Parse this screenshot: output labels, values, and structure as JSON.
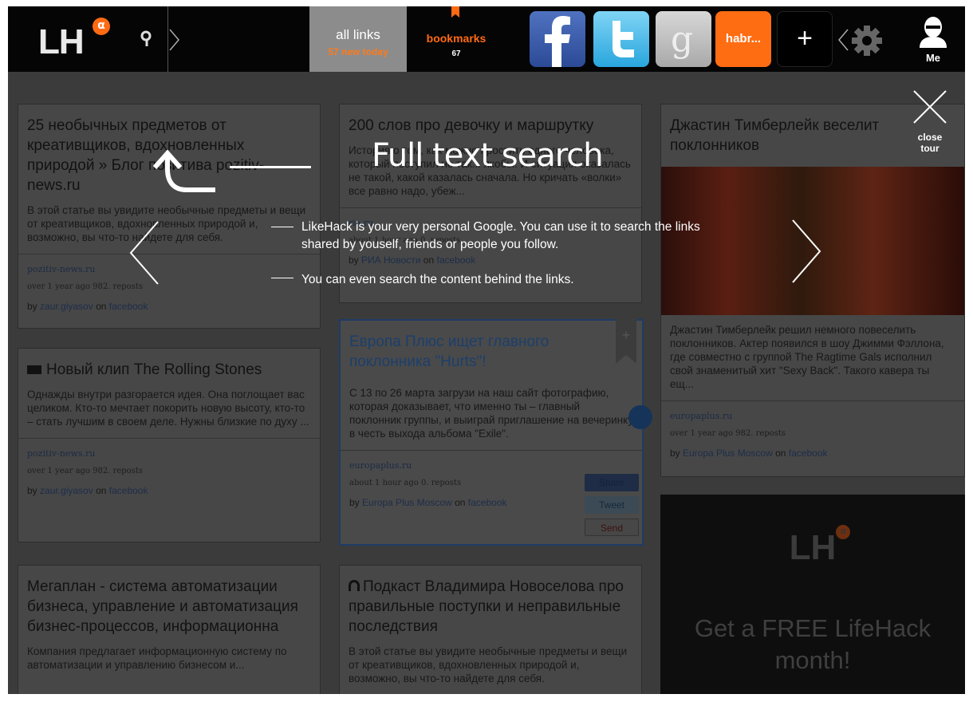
{
  "topbar": {
    "logo_text": "LH",
    "logo_badge": "α",
    "tabs": [
      {
        "label": "all links",
        "sub": "57 new today"
      },
      {
        "label": "bookmarks",
        "sub": "67"
      }
    ],
    "services": [
      {
        "name": "facebook-icon"
      },
      {
        "name": "twitter-icon"
      },
      {
        "name": "google-icon"
      },
      {
        "label": "habr..."
      },
      {
        "label": "+"
      }
    ],
    "user_label": "Me"
  },
  "cards": {
    "c1": {
      "title": "25 необычных предметов от креативщиков, вдохновленных природой » Блог позитива pozitiv-news.ru",
      "desc": "В этой статье вы увидите необычные предметы и вещи от креативщиков, вдохновленных природой и, возможно, вы что-то найдете для себя.",
      "source": "pozitiv-news.ru",
      "meta": "over 1 year ago 982. reposts",
      "by_prefix": "by",
      "author": "zaur.giyasov",
      "on": "on",
      "network": "facebook"
    },
    "c2": {
      "title": "200 слов про девочку и маршрутку",
      "desc": "История о том, как можно простить одного человека, который поступил не так... якобы. И ситуация оказалась не такой, какой казалась сначала. Но кричать «волки» все равно надо, убеж...",
      "source": "ria.ru",
      "meta": "about 1 hour ago 0. reposts",
      "by_prefix": "by",
      "author": "РИА Новости",
      "on": "on",
      "network": "facebook"
    },
    "c3": {
      "title": "Джастин Тимберлейк веселит поклонников",
      "desc": "Джастин Тимберлейк решил немного повеселить поклонников. Актер появился в шоу Джимми Фэллона, где совместно с группой The Ragtime Gals исполнил свой знаменитый хит \"Sexy Back\". Такого кавера ты ещ...",
      "source": "europaplus.ru",
      "meta": "over 1 year ago 982. reposts",
      "by_prefix": "by",
      "author": "Europa Plus Moscow",
      "on": "on",
      "network": "facebook"
    },
    "c4": {
      "title": "Новый клип The Rolling Stones",
      "desc": "Однажды внутри разгорается идея. Она поглощает вас целиком. Кто-то мечтает покорить новую высоту, кто-то – стать лучшим в своем деле. Нужны близкие по духу ...",
      "source": "pozitiv-news.ru",
      "meta": "over 1 year ago 982. reposts",
      "by_prefix": "by",
      "author": "zaur.giyasov",
      "on": "on",
      "network": "facebook"
    },
    "c5": {
      "title": "Европа Плюс ищет главного поклонника \"Hurts\"!",
      "desc": "С 13 по 26 марта загрузи на наш сайт фотографию, которая доказывает, что именно ты – главный поклонник группы, и выиграй приглашение на вечеринку в честь выхода альбома \"Exile\".",
      "source": "europaplus.ru",
      "meta": "about 1 hour ago 0. reposts",
      "by_prefix": "by",
      "author": "Europa Plus Moscow",
      "on": "on",
      "network": "facebook",
      "ribbon": "+",
      "share_fb": "Share",
      "share_tw": "Tweet",
      "share_mail": "Send"
    },
    "c6": {
      "title": "Мегаплан - система автоматизации бизнеса, управление и автоматизация бизнес-процессов, информационна",
      "desc": "Компания предлагает информационную систему по автоматизации и управлению бизнесом и..."
    },
    "c7": {
      "title": "Подкаст Владимира Новоселова про правильные поступки и неправильные последствия",
      "desc": "В этой статье вы увидите необычные предметы и вещи от креативщиков, вдохновленных природой и, возможно, вы что-то найдете для себя."
    }
  },
  "promo": {
    "logo_text": "LH",
    "logo_badge": "α",
    "text": "Get a FREE LifeHack month!"
  },
  "tour": {
    "title": "Full text search",
    "bullet1": "LikeHack is your very personal Google. You can  use it to search the links shared by youself, friends or people you follow.",
    "bullet2": "You can even search the content behind the links.",
    "close_label": "close tour"
  }
}
